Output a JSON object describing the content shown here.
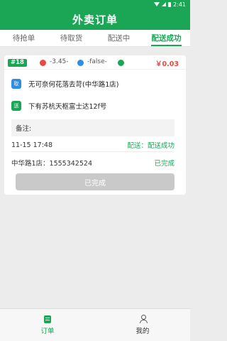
{
  "status_bar": {
    "time": "2:41"
  },
  "header": {
    "title": "外卖订单"
  },
  "tabs": [
    {
      "label": "待抢单",
      "active": false
    },
    {
      "label": "待取货",
      "active": false
    },
    {
      "label": "配送中",
      "active": false
    },
    {
      "label": "配送成功",
      "active": true
    }
  ],
  "order": {
    "number": "#18",
    "tag_red": "-3.45-",
    "tag_blue": "-false-",
    "price": "￥0.03",
    "pickup_badge": "取",
    "pickup_address": "无可奈何花落去苛(中华路1店)",
    "delivery_badge": "送",
    "delivery_address": "下有苏杭天枢富士达12f号",
    "remark_label": "备注:",
    "datetime": "11-15 17:48",
    "delivery_status": "配送：配送成功",
    "store_phone": "中华路1店：1555342524",
    "completion_status": "已完成",
    "done_button": "已完成"
  },
  "bottom_nav": [
    {
      "label": "订单",
      "icon": "orders-icon",
      "active": true
    },
    {
      "label": "我的",
      "icon": "user-icon",
      "active": false
    }
  ],
  "colors": {
    "primary": "#1aa654",
    "price_red": "#e8483f",
    "blue": "#2f8de4"
  }
}
